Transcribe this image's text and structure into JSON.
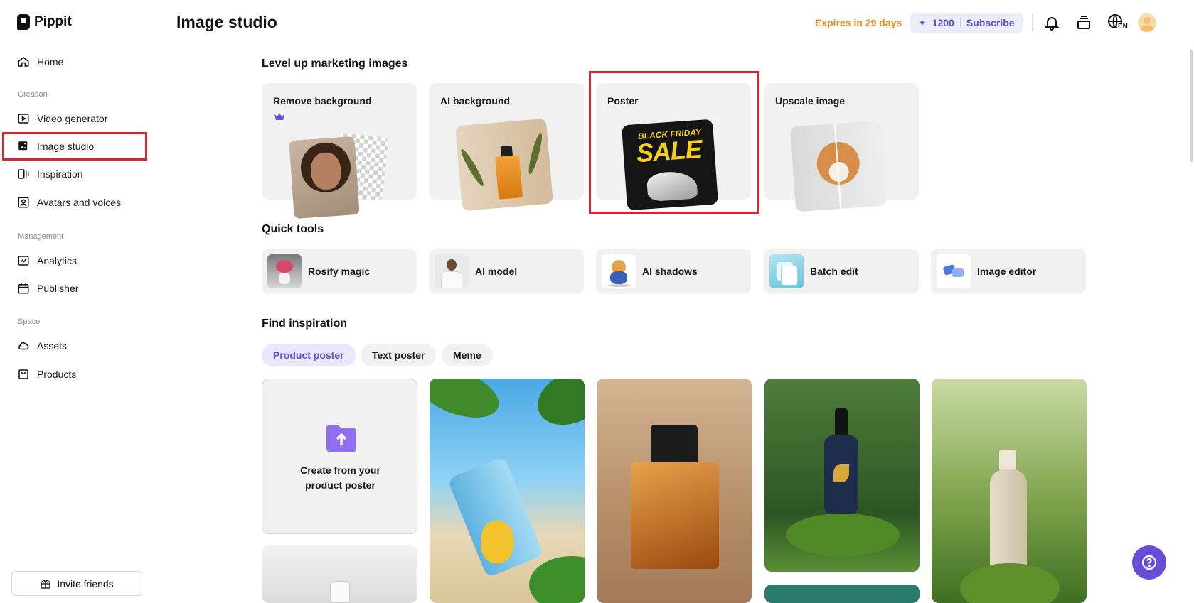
{
  "app": {
    "name": "Pippit"
  },
  "sidebar": {
    "home": "Home",
    "sections": {
      "creation": "Creation",
      "management": "Management",
      "space": "Space"
    },
    "items": {
      "video_generator": "Video generator",
      "image_studio": "Image studio",
      "inspiration": "Inspiration",
      "avatars_voices": "Avatars and voices",
      "analytics": "Analytics",
      "publisher": "Publisher",
      "assets": "Assets",
      "products": "Products"
    },
    "invite": "Invite friends",
    "active_item": "Image studio"
  },
  "header": {
    "title": "Image studio",
    "expires": "Expires in 29 days",
    "credits": "1200",
    "subscribe": "Subscribe",
    "language": "EN"
  },
  "sections": {
    "level_up": "Level up marketing images",
    "quick_tools": "Quick tools",
    "find_inspiration": "Find inspiration"
  },
  "feature_cards": {
    "remove_background": "Remove background",
    "ai_background": "AI background",
    "poster": "Poster",
    "upscale_image": "Upscale image",
    "poster_badge_line1": "BLACK FRIDAY",
    "poster_badge_line2": "SALE"
  },
  "quick_tools": {
    "rosify": "Rosify magic",
    "ai_model": "AI model",
    "ai_shadows": "AI shadows",
    "batch_edit": "Batch edit",
    "image_editor": "Image editor"
  },
  "filters": {
    "product_poster": "Product poster",
    "text_poster": "Text poster",
    "meme": "Meme",
    "active": "Product poster"
  },
  "create_card": {
    "line1": "Create from your",
    "line2": "product poster"
  },
  "colors": {
    "accent": "#5b4fd6",
    "highlight": "#e0212e",
    "expires": "#f08c1e",
    "help": "#6a4cd6"
  }
}
